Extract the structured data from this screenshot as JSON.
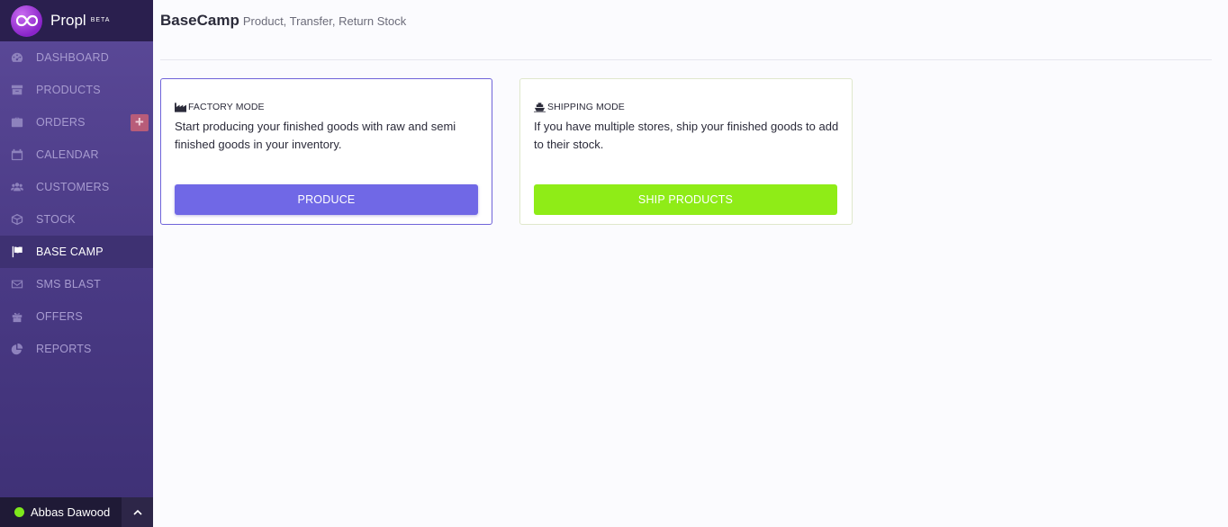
{
  "brand": {
    "name": "Propl",
    "badge": "BETA"
  },
  "sidebar": {
    "items": [
      {
        "label": "DASHBOARD",
        "icon": "dashboard-icon"
      },
      {
        "label": "PRODUCTS",
        "icon": "archive-icon"
      },
      {
        "label": "ORDERS",
        "icon": "briefcase-icon",
        "add_label": "+"
      },
      {
        "label": "CALENDAR",
        "icon": "calendar-icon"
      },
      {
        "label": "CUSTOMERS",
        "icon": "users-icon"
      },
      {
        "label": "STOCK",
        "icon": "cube-icon"
      },
      {
        "label": "BASE CAMP",
        "icon": "flag-icon",
        "active": true
      },
      {
        "label": "SMS BLAST",
        "icon": "envelope-icon"
      },
      {
        "label": "OFFERS",
        "icon": "gift-icon"
      },
      {
        "label": "REPORTS",
        "icon": "pie-chart-icon"
      }
    ]
  },
  "user": {
    "name": "Abbas Dawood",
    "status_color": "#7ee81c"
  },
  "header": {
    "title": "BaseCamp",
    "subtitle": "Product, Transfer, Return Stock"
  },
  "cards": {
    "factory": {
      "mode": "FACTORY MODE",
      "icon": "factory-icon",
      "description": "Start producing your finished goods with raw and semi finished goods in your inventory.",
      "button": "PRODUCE",
      "accent": "#7068e6"
    },
    "shipping": {
      "mode": "SHIPPING MODE",
      "icon": "ship-icon",
      "description": "If you have multiple stores, ship your finished goods to add to their stock.",
      "button": "SHIP PRODUCTS",
      "accent": "#8fec17"
    }
  }
}
